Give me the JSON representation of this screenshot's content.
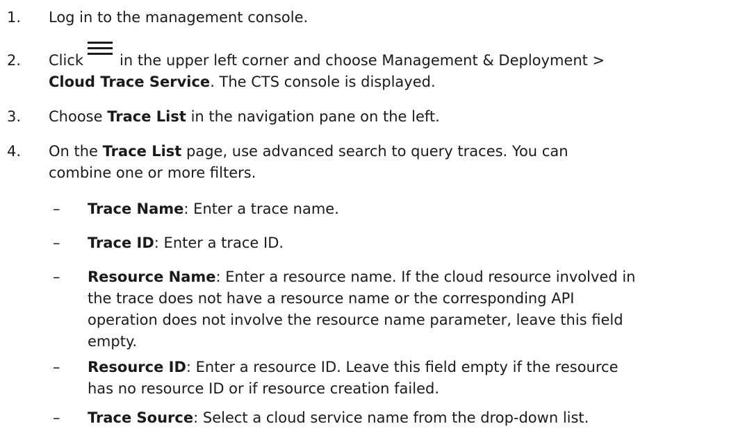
{
  "steps": [
    {
      "num": "1.",
      "text": "Log in to the management console."
    },
    {
      "num": "2.",
      "pre": "Click",
      "post": "in the upper left corner and choose Management & Deployment >",
      "bold": "Cloud Trace Service",
      "tail": ". The CTS console is displayed.",
      "icon": "menu-icon"
    },
    {
      "num": "3.",
      "pre": "Choose ",
      "bold": "Trace List",
      "post": " in the navigation pane on the left."
    },
    {
      "num": "4.",
      "pre": "On the ",
      "bold": "Trace List",
      "post": " page, use advanced search to query traces. You can",
      "line2": "combine one or more filters."
    }
  ],
  "filters": [
    {
      "dash": "–",
      "term": "Trace Name",
      "desc": ": Enter a trace name."
    },
    {
      "dash": "–",
      "term": "Trace ID",
      "desc": ": Enter a trace ID."
    },
    {
      "dash": "–",
      "term": "Resource Name",
      "desc": ": Enter a resource name. If the cloud resource involved in",
      "more": [
        "the trace does not have a resource name or the corresponding API",
        "operation does not involve the resource name parameter, leave this field",
        "empty."
      ]
    },
    {
      "dash": "–",
      "term": "Resource ID",
      "desc": ": Enter a resource ID. Leave this field empty if the resource",
      "more": [
        "has no resource ID or if resource creation failed."
      ]
    },
    {
      "dash": "–",
      "term": "Trace Source",
      "desc": ": Select a cloud service name from the drop-down list."
    }
  ]
}
